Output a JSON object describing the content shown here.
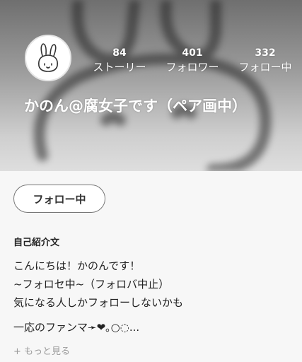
{
  "profile": {
    "display_name": "かのん@腐女子です（ペア画中）",
    "avatar_icon": "bunny-doodle-icon"
  },
  "stats": {
    "stories": {
      "count": "84",
      "label": "ストーリー"
    },
    "followers": {
      "count": "401",
      "label": "フォロワー"
    },
    "following": {
      "count": "332",
      "label": "フォロー中"
    }
  },
  "actions": {
    "follow_button_label": "フォロー中"
  },
  "bio": {
    "heading": "自己紹介文",
    "lines": [
      "こんにちは！かのんです！",
      "~フォロセ中~（フォロバ中止）",
      "気になる人しかフォローしないかも",
      "一応のファンマ➛❤︎｡○◌..."
    ],
    "see_more_label": "+ もっと見る"
  },
  "colors": {
    "header_bg": "#8a8a8a",
    "page_bg": "#f7f7f7",
    "button_border": "#777777"
  }
}
